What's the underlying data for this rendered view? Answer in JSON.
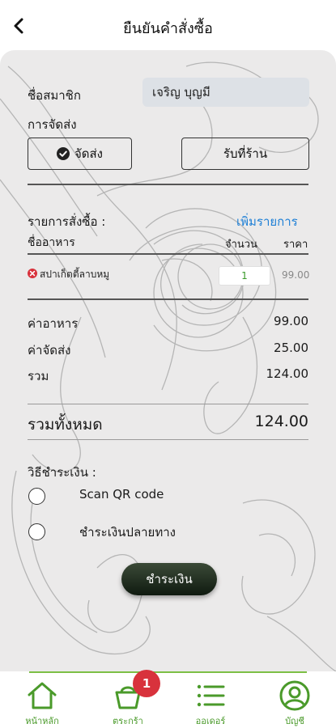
{
  "header": {
    "title": "ยืนยันคำสั่งซื้อ"
  },
  "member": {
    "label": "ชื่อสมาชิก",
    "value": "เจริญ บุญมี"
  },
  "delivery": {
    "label": "การจัดส่ง",
    "options": [
      {
        "label": "จัดส่ง",
        "selected": true
      },
      {
        "label": "รับที่ร้าน",
        "selected": false
      }
    ]
  },
  "order": {
    "title": "รายการสั่งซื้อ :",
    "add_link": "เพิ่มรายการ",
    "col_name": "ชื่ออาหาร",
    "col_qty": "จำนวน",
    "col_price": "ราคา",
    "items": [
      {
        "name": "สปาเก็ตตี้ลาบหมู",
        "qty": "1",
        "price": "99.00"
      }
    ]
  },
  "summary": {
    "food_label": "ค่าอาหาร",
    "food_value": "99.00",
    "shipping_label": "ค่าจัดส่ง",
    "shipping_value": "25.00",
    "sum_label": "รวม",
    "sum_value": "124.00",
    "total_label": "รวมทั้งหมด",
    "total_value": "124.00"
  },
  "payment": {
    "title": "วิธีชำระเงิน :",
    "methods": [
      {
        "label": "Scan QR code",
        "selected": false
      },
      {
        "label": "ชำระเงินปลายทาง",
        "selected": false
      }
    ],
    "pay_button": "ชำระเงิน"
  },
  "tabs": [
    {
      "label": "หน้าหลัก",
      "icon": "home-icon"
    },
    {
      "label": "ตระกร้า",
      "icon": "basket-icon",
      "badge": "1"
    },
    {
      "label": "ออเดอร์",
      "icon": "list-icon"
    },
    {
      "label": "บัญชี",
      "icon": "user-icon"
    }
  ],
  "colors": {
    "accent_green": "#7cbf45",
    "link_blue": "#1d7fd6",
    "badge_red": "#d8323c"
  }
}
